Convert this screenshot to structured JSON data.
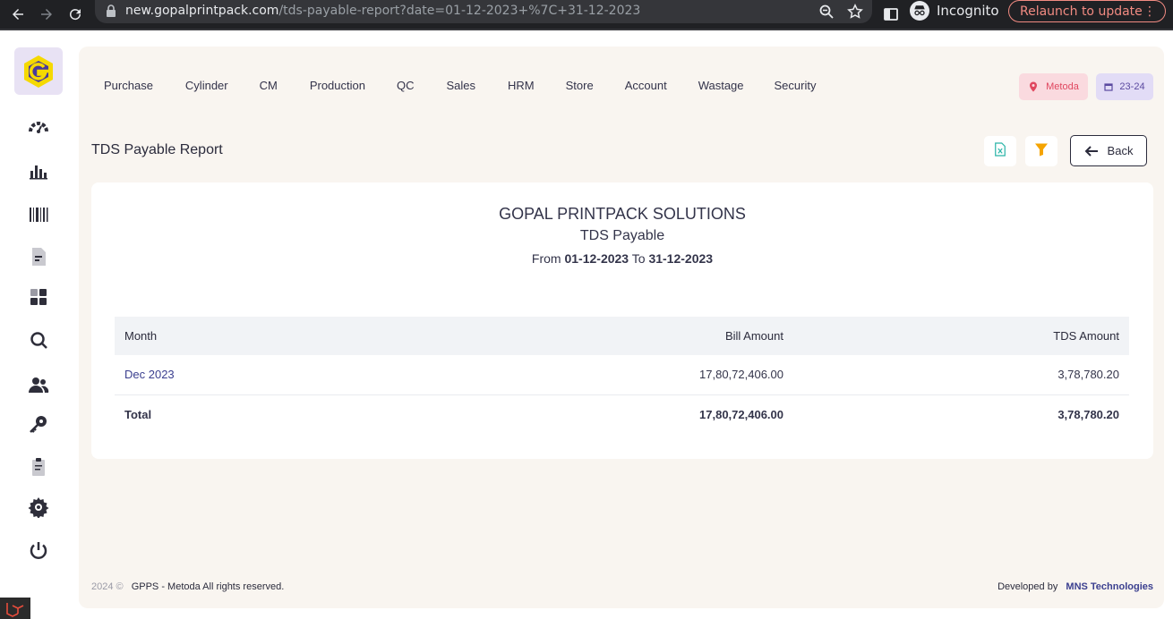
{
  "browser": {
    "url_host": "new.gopalprintpack.com",
    "url_path": "/tds-payable-report?date=01-12-2023+%7C+31-12-2023",
    "incognito_label": "Incognito",
    "relaunch_label": "Relaunch to update"
  },
  "topnav": {
    "items": [
      "Purchase",
      "Cylinder",
      "CM",
      "Production",
      "QC",
      "Sales",
      "HRM",
      "Store",
      "Account",
      "Wastage",
      "Security"
    ]
  },
  "badges": {
    "branch": "Metoda",
    "year": "23-24"
  },
  "page": {
    "title": "TDS Payable Report",
    "back_label": "Back"
  },
  "report": {
    "company": "GOPAL PRINTPACK SOLUTIONS",
    "name": "TDS Payable",
    "from_label": "From",
    "from_date": "01-12-2023",
    "to_label": "To",
    "to_date": "31-12-2023",
    "columns": [
      "Month",
      "Bill Amount",
      "TDS Amount"
    ],
    "rows": [
      {
        "month": "Dec 2023",
        "bill_amount": "17,80,72,406.00",
        "tds_amount": "3,78,780.20"
      }
    ],
    "total": {
      "label": "Total",
      "bill_amount": "17,80,72,406.00",
      "tds_amount": "3,78,780.20"
    }
  },
  "footer": {
    "year": "2024 ©",
    "text": "GPPS - Metoda All rights reserved.",
    "developed_by": "Developed by",
    "developer": "MNS Technologies"
  },
  "sidebar_icons": [
    "dashboard-gauge-icon",
    "bar-chart-icon",
    "barcode-icon",
    "document-icon",
    "widgets-icon",
    "search-icon",
    "users-icon",
    "key-icon",
    "clipboard-icon",
    "gear-icon",
    "power-icon"
  ]
}
